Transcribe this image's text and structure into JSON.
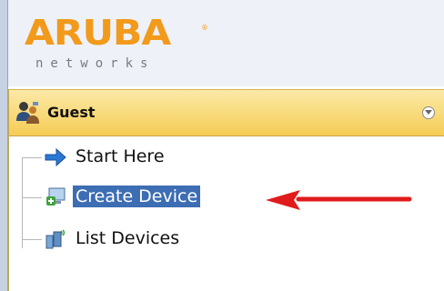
{
  "logo": {
    "brand": "ARUBA",
    "tagline": "networks",
    "trademark": "®",
    "color": "#f29a1c"
  },
  "panel": {
    "title": "Guest",
    "icon": "guest-users-icon",
    "collapse_icon": "collapse-circle-icon",
    "header_color": "#f5cd55"
  },
  "nav": {
    "items": [
      {
        "label": "Start Here",
        "icon": "blue-arrow-icon",
        "selected": false
      },
      {
        "label": "Create Device",
        "icon": "add-device-icon",
        "selected": true
      },
      {
        "label": "List Devices",
        "icon": "devices-list-icon",
        "selected": false
      }
    ],
    "selected_color": "#3d6db3"
  },
  "annotation": {
    "icon": "red-arrow-icon",
    "color": "#e01b1b"
  }
}
